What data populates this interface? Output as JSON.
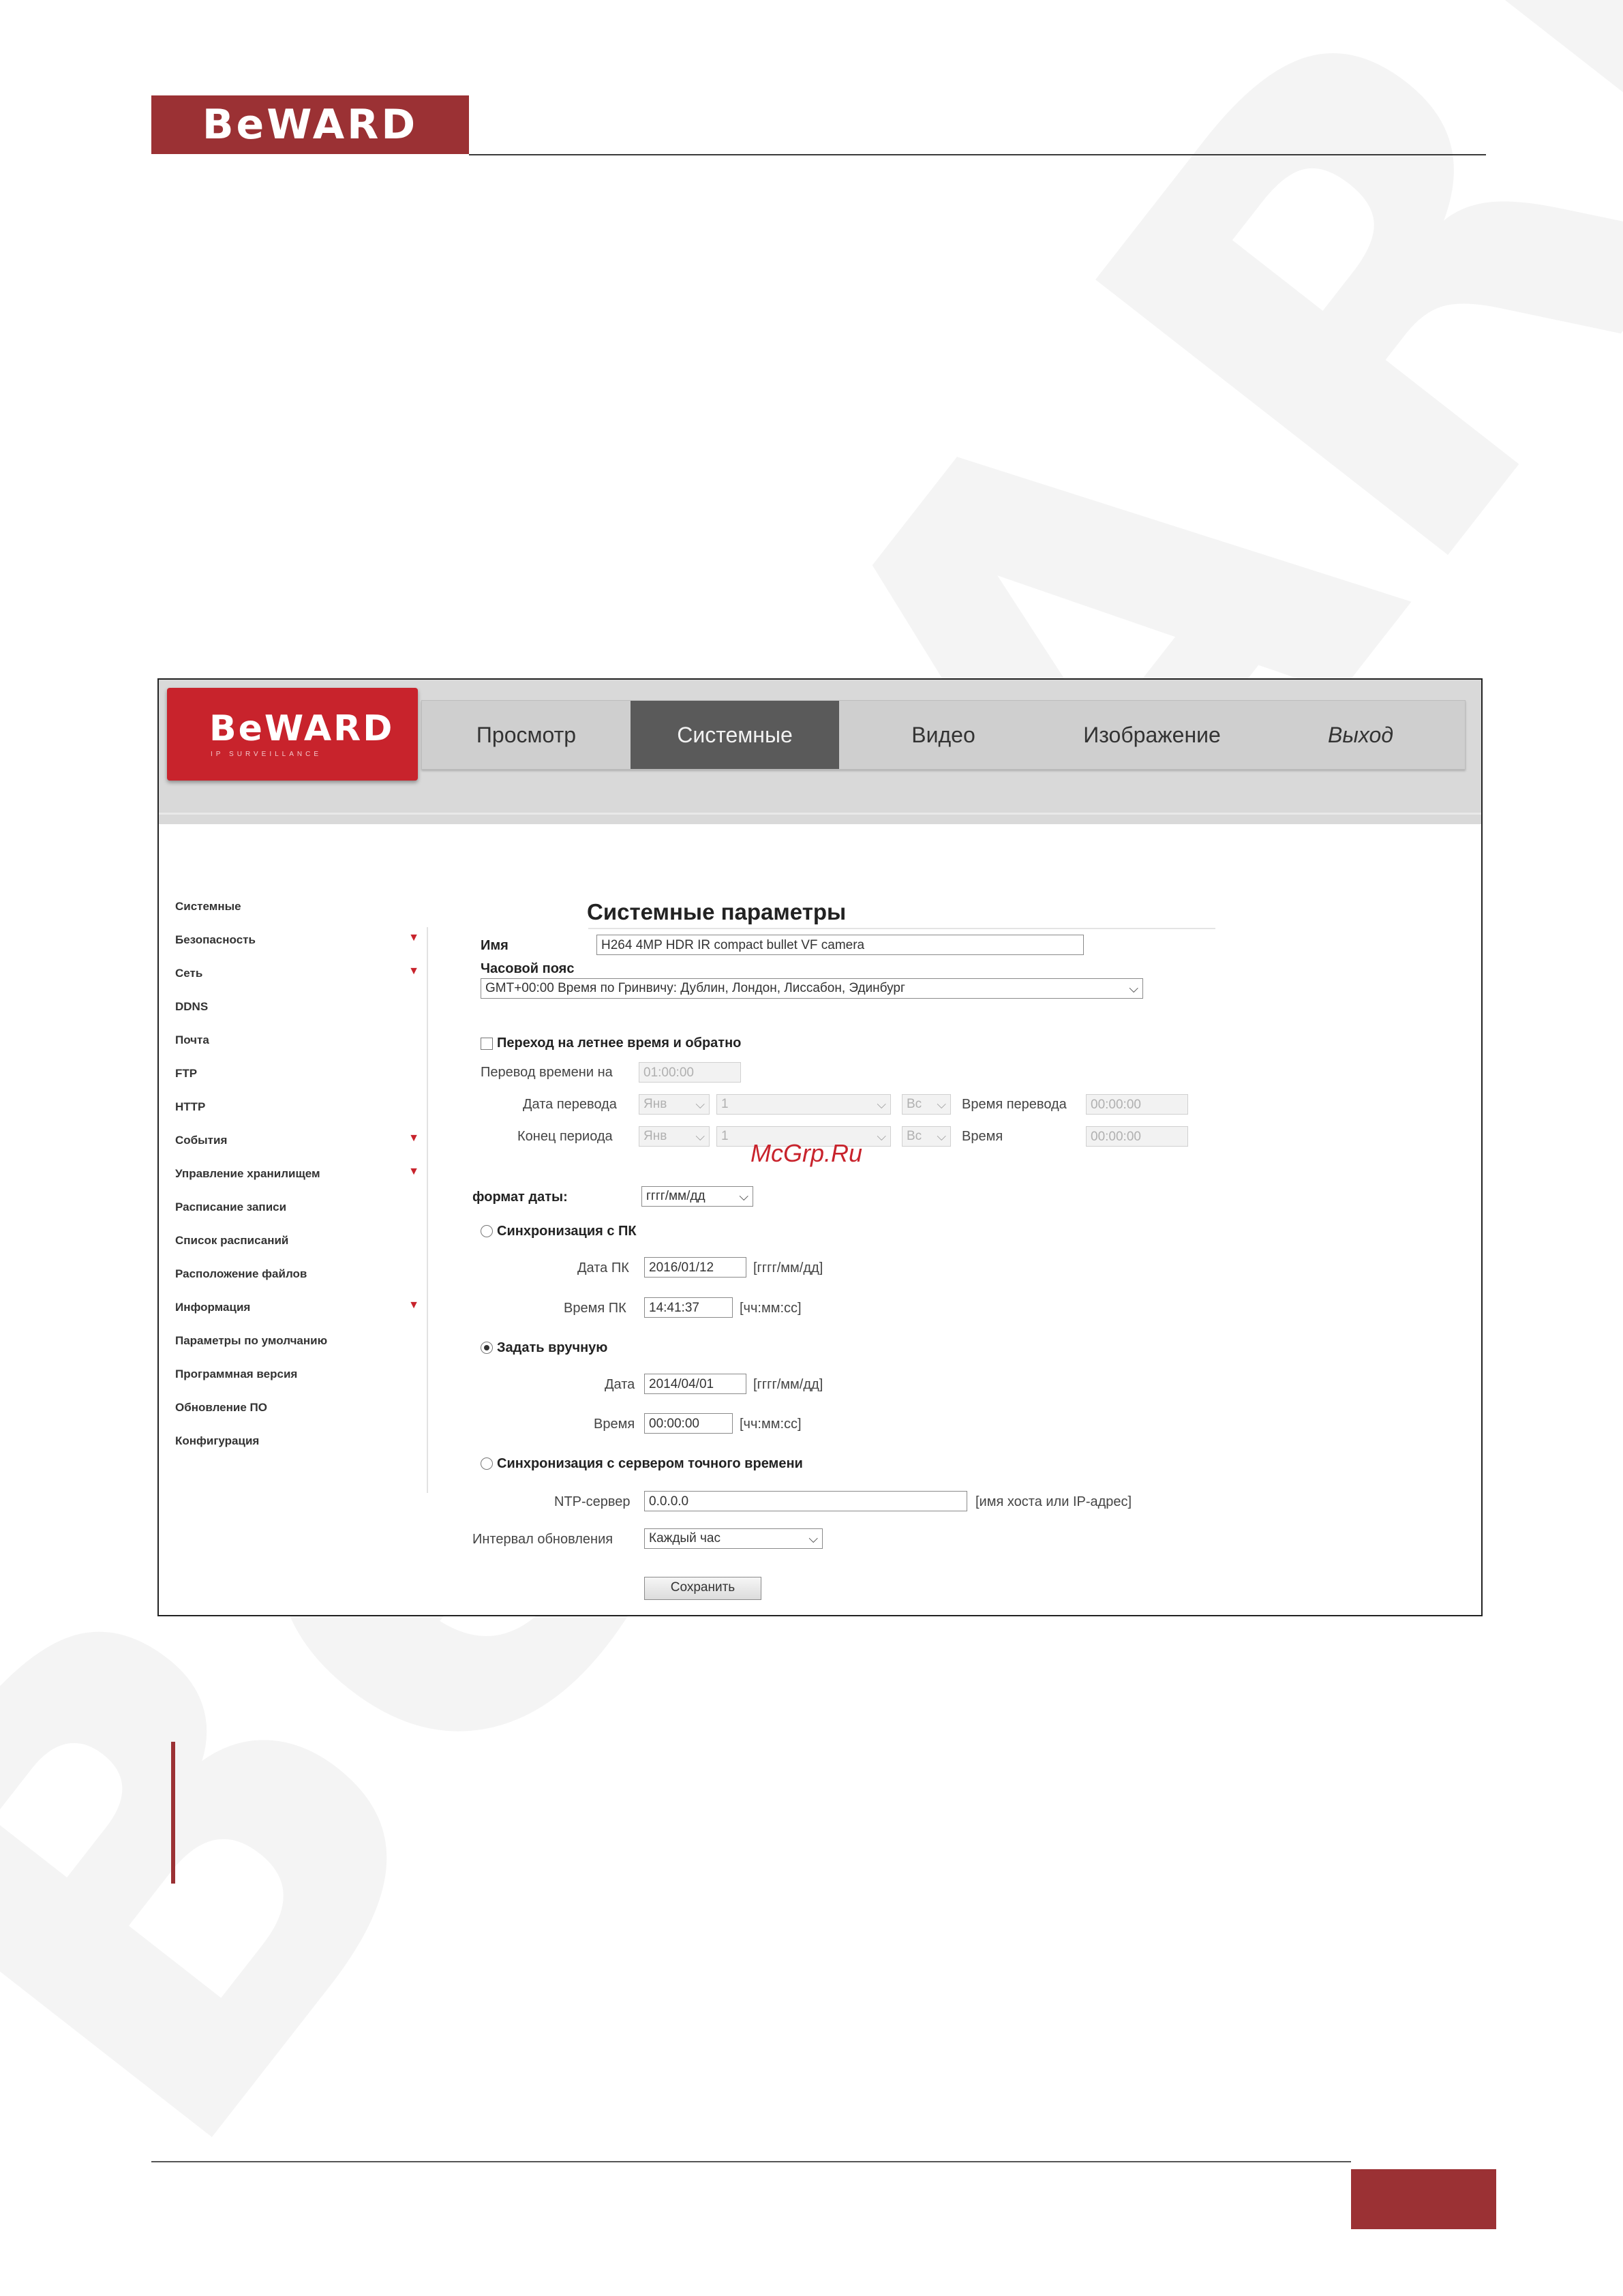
{
  "page": {
    "logo_text": "BeWARD",
    "watermark_text": "BeWARD",
    "footer_page_number": ""
  },
  "camera_ui": {
    "logo": {
      "brand": "BeWARD",
      "sub": "IP SURVEILLANCE"
    },
    "tabs": [
      {
        "label": "Просмотр"
      },
      {
        "label": "Системные",
        "active": true
      },
      {
        "label": "Видео"
      },
      {
        "label": "Изображение"
      },
      {
        "label": "Выход"
      }
    ],
    "sidebar": [
      {
        "label": "Системные",
        "arrow": false
      },
      {
        "label": "Безопасность",
        "arrow": true
      },
      {
        "label": "Сеть",
        "arrow": true
      },
      {
        "label": "DDNS",
        "arrow": false
      },
      {
        "label": "Почта",
        "arrow": false
      },
      {
        "label": "FTP",
        "arrow": false
      },
      {
        "label": "HTTP",
        "arrow": false
      },
      {
        "label": "События",
        "arrow": true
      },
      {
        "label": "Управление хранилищем",
        "arrow": true
      },
      {
        "label": "Расписание записи",
        "arrow": false
      },
      {
        "label": "Список расписаний",
        "arrow": false
      },
      {
        "label": "Расположение файлов",
        "arrow": false
      },
      {
        "label": "Информация",
        "arrow": true
      },
      {
        "label": "Параметры по умолчанию",
        "arrow": false
      },
      {
        "label": "Программная версия",
        "arrow": false
      },
      {
        "label": "Обновление ПО",
        "arrow": false
      },
      {
        "label": "Конфигурация",
        "arrow": false
      }
    ],
    "form": {
      "title": "Системные параметры",
      "name_label": "Имя",
      "name_value": "H264 4MP HDR IR compact bullet VF camera",
      "timezone_label": "Часовой пояс",
      "timezone_value": "GMT+00:00 Время по Гринвичу: Дублин, Лондон, Лиссабон, Эдинбург",
      "dst": {
        "checkbox_label": "Переход на летнее время и обратно",
        "checked": false,
        "shift_label": "Перевод времени на",
        "shift_value": "01:00:00",
        "start_label": "Дата перевода",
        "start_month": "Янв",
        "start_week": "1",
        "start_day": "Вс",
        "start_time_label": "Время перевода",
        "start_time": "00:00:00",
        "end_label": "Конец периода",
        "end_month": "Янв",
        "end_week": "1",
        "end_day": "Вс",
        "end_time_label": "Время",
        "end_time": "00:00:00"
      },
      "date_format_label": "формат даты:",
      "date_format_value": "гггг/мм/дд",
      "sync_pc": {
        "label": "Синхронизация с ПК",
        "selected": false,
        "pc_date_label": "Дата ПК",
        "pc_date": "2016/01/12",
        "pc_date_hint": "[гггг/мм/дд]",
        "pc_time_label": "Время ПК",
        "pc_time": "14:41:37",
        "pc_time_hint": "[чч:мм:сс]"
      },
      "manual": {
        "label": "Задать вручную",
        "selected": true,
        "date_label": "Дата",
        "date": "2014/04/01",
        "date_hint": "[гггг/мм/дд]",
        "time_label": "Время",
        "time": "00:00:00",
        "time_hint": "[чч:мм:сс]"
      },
      "ntp": {
        "label": "Синхронизация с сервером точного времени",
        "selected": false,
        "server_label": "NTP-сервер",
        "server": "0.0.0.0",
        "server_hint": "[имя хоста или IP-адрес]",
        "interval_label": "Интервал обновления",
        "interval": "Каждый час"
      },
      "save_label": "Сохранить"
    },
    "overlay_watermark": "McGrp.Ru"
  }
}
